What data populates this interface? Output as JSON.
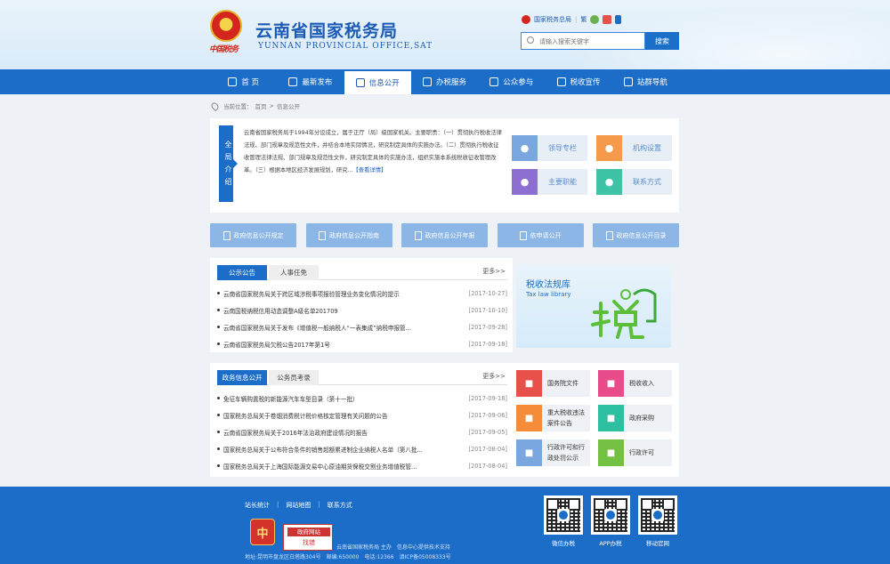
{
  "header": {
    "brand_cn": "云南省国家税务局",
    "brand_en": "YUNNAN PROVINCIAL OFFICE,SAT",
    "emblem_text": "中国税务",
    "top_link": "国家税务总局",
    "lang_toggle": "繁",
    "search_placeholder": "请输入搜索关键字",
    "search_button": "搜索"
  },
  "nav": {
    "items": [
      {
        "label": "首 页",
        "icon": "home-icon"
      },
      {
        "label": "最新发布",
        "icon": "rocket-icon"
      },
      {
        "label": "信息公开",
        "icon": "document-icon"
      },
      {
        "label": "办税服务",
        "icon": "id-card-icon"
      },
      {
        "label": "公众参与",
        "icon": "people-icon"
      },
      {
        "label": "税收宣传",
        "icon": "megaphone-icon"
      },
      {
        "label": "站群导航",
        "icon": "sitemap-icon"
      }
    ],
    "active": 2
  },
  "breadcrumb": {
    "prefix": "当前位置：",
    "home": "首页",
    "sep": ">",
    "current": "信息公开"
  },
  "intro": {
    "tag": "全局介绍",
    "text": "云南省国家税务局于1994年分设成立，属于正厅（局）级国家机关。主要职责：（一）贯彻执行税收法律法规、部门规章及规范性文件，并结合本地实际情况，研究制定具体的实施办法。（二）贯彻执行税收征收管理法律法规、部门规章及规范性文件，研究制定具体的实施办法，组织实施本系统税收征收管理改革。（三）根据本地区经济发展规划，研究...",
    "more": "【查看详情】",
    "tiles": [
      {
        "label": "领导专栏",
        "color": "#7aa7df",
        "icon": "leader-icon"
      },
      {
        "label": "机构设置",
        "color": "#f59a4b",
        "icon": "org-chart-icon"
      },
      {
        "label": "主要职能",
        "color": "#8c6fd1",
        "icon": "function-icon"
      },
      {
        "label": "联系方式",
        "color": "#3fc3a7",
        "icon": "phone-icon"
      }
    ]
  },
  "quick_buttons": [
    "政府信息公开规定",
    "政府信息公开指南",
    "政府信息公开年报",
    "依申请公开",
    "政府信息公开目录"
  ],
  "news1": {
    "tabs": [
      "公示公告",
      "人事任免"
    ],
    "more": "更多>>",
    "items": [
      {
        "title": "云南省国家税务局关于跨区域涉税事项报验管理业务变化情况的提示",
        "date": "[2017-10-27]"
      },
      {
        "title": "云南国税纳税信用动态调整A级名单201709",
        "date": "[2017-10-10]"
      },
      {
        "title": "云南省国家税务局关于发布《增值税一般纳税人“一表集成”纳税申报管...",
        "date": "[2017-09-28]"
      },
      {
        "title": "云南省国家税务局欠税公告2017年第1号",
        "date": "[2017-09-18]"
      }
    ]
  },
  "news2": {
    "tabs": [
      "政务信息公开",
      "公务员考录"
    ],
    "more": "更多>>",
    "items": [
      {
        "title": "免征车辆购置税的新能源汽车车型目录（第十一批）",
        "date": "[2017-09-18]"
      },
      {
        "title": "国家税务总局关于卷烟消费税计税价格核定管理有关问题的公告",
        "date": "[2017-09-06]"
      },
      {
        "title": "云南省国家税务局关于2016年法治政府建设情况的报告",
        "date": "[2017-09-05]"
      },
      {
        "title": "国家税务总局关于公布符合条件的销售超额累进制企业纳税人名单（第八批...",
        "date": "[2017-08-04]"
      },
      {
        "title": "国家税务总局关于上海国际能源交易中心原油期货保税交割业务增值税管...",
        "date": "[2017-08-04]"
      }
    ]
  },
  "law_library": {
    "title_cn": "税收法规库",
    "title_en": "Tax law library",
    "art_text": "税"
  },
  "grid_tiles": [
    {
      "label": "国务院文件",
      "color": "#e8504a",
      "icon": "edit-icon"
    },
    {
      "label": "税收收入",
      "color": "#e94c8a",
      "icon": "chart-icon"
    },
    {
      "label": "重大税收违法案件公告",
      "color": "#f58c3a",
      "icon": "case-icon"
    },
    {
      "label": "政府采购",
      "color": "#2cc0a0",
      "icon": "cart-icon"
    },
    {
      "label": "行政许可和行政处罚公示",
      "color": "#7aa7df",
      "icon": "stamp-icon"
    },
    {
      "label": "行政许可",
      "color": "#74c043",
      "icon": "license-icon"
    }
  ],
  "footer": {
    "links": [
      "站长统计",
      "网站地图",
      "联系方式"
    ],
    "sep": "|",
    "badge_text": "中",
    "zc_top": "政府网站",
    "zc_bottom": "找错",
    "host": "云南省国家税务局 主办　信息中心提供技术支持",
    "address": "地址:昆明市盘龙区白塔路304号　邮编:650000　电话:12366　滇ICP备05008333号",
    "qr": [
      {
        "label": "微信办税"
      },
      {
        "label": "APP办税"
      },
      {
        "label": "移动官网"
      }
    ]
  }
}
